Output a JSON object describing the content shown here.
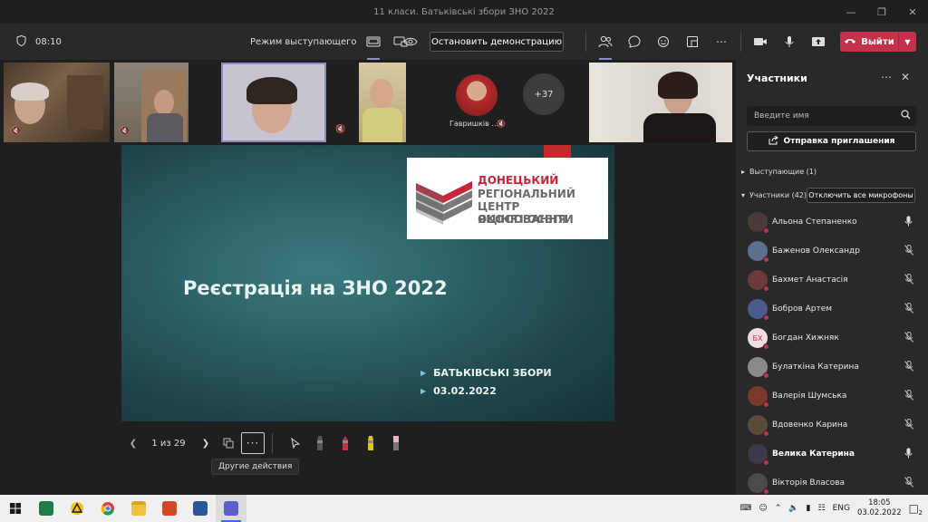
{
  "window": {
    "title": "11 класи. Батьківські збори ЗНО 2022"
  },
  "toolbar": {
    "timer": "08:10",
    "presenter_mode_label": "Режим выступающего",
    "stop_presenting_label": "Остановить демонстрацию",
    "leave_label": "Выйти"
  },
  "video_strip": {
    "tiles": [
      {
        "name": "Гавришків ...",
        "muted": true
      },
      {
        "overflow_count": "+37"
      }
    ]
  },
  "slide": {
    "logo_lines": [
      "ДОНЕЦЬКИЙ",
      "РЕГІОНАЛЬНИЙ",
      "ЦЕНТР ОЦІНЮВАННЯ",
      "ЯКОСТІ ОСВІТИ"
    ],
    "title": "Реєстрація на ЗНО 2022",
    "bullets": [
      "БАТЬКІВСЬКІ ЗБОРИ",
      "03.02.2022"
    ]
  },
  "slide_controls": {
    "page_indicator": "1 из 29",
    "tooltip": "Другие действия"
  },
  "participants_panel": {
    "title": "Участники",
    "search_placeholder": "Введите имя",
    "invite_label": "Отправка приглашения",
    "presenters_section": "Выступающие (1)",
    "attendees_section": "Участники (42)",
    "mute_all_label": "Отключить все микрофоны",
    "people": [
      {
        "name": "Альона Степаненко",
        "mic": "on",
        "avatar_color": "#4a3a3a"
      },
      {
        "name": "Баженов Олександр",
        "mic": "muted",
        "avatar_color": "#5b6f8f"
      },
      {
        "name": "Бахмет Анастасія",
        "mic": "muted",
        "avatar_color": "#6b3a3a"
      },
      {
        "name": "Бобров Артем",
        "mic": "muted",
        "avatar_color": "#4a5a8a"
      },
      {
        "name": "Богдан Хижняк",
        "mic": "muted",
        "initials": "БХ",
        "avatar_color": "#f4dde0"
      },
      {
        "name": "Булаткіна Катерина",
        "mic": "muted",
        "avatar_color": "#8a8a8a"
      },
      {
        "name": "Валерія Шумська",
        "mic": "muted",
        "avatar_color": "#7a3a2a"
      },
      {
        "name": "Вдовенко Карина",
        "mic": "muted",
        "avatar_color": "#5a4a3a"
      },
      {
        "name": "Велика Катерина",
        "mic": "on",
        "avatar_color": "#3a3a4a",
        "highlight": true
      },
      {
        "name": "Вікторія Власова",
        "mic": "muted",
        "avatar_color": "#4a4a4a"
      }
    ]
  },
  "taskbar": {
    "lang": "ENG",
    "time": "18:05",
    "date": "03.02.2022",
    "notifications": "2"
  }
}
